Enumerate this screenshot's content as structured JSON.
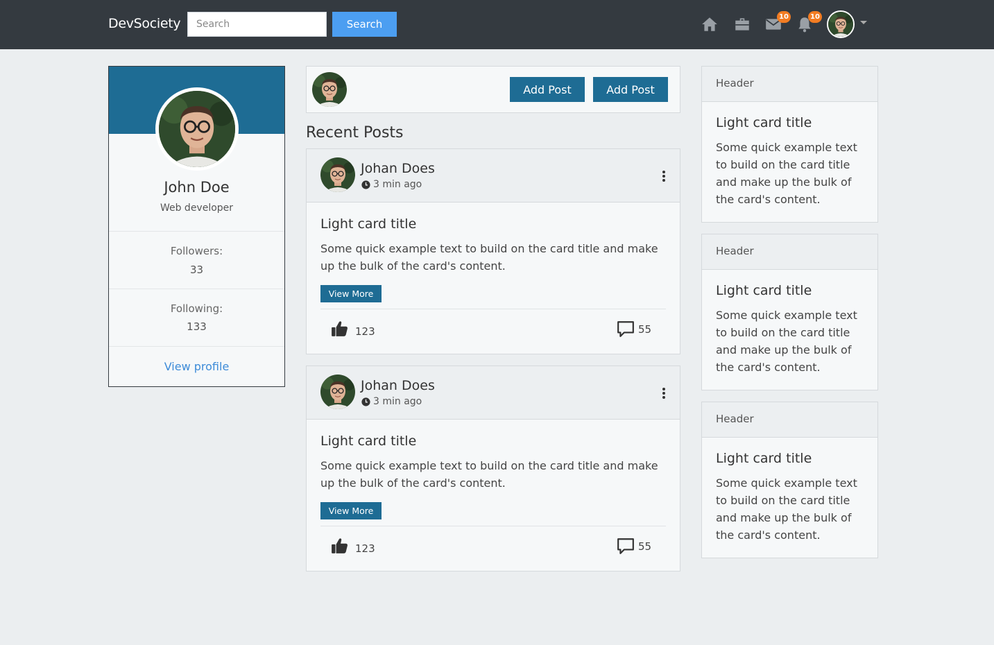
{
  "navbar": {
    "brand": "DevSociety",
    "search_placeholder": "Search",
    "search_button": "Search",
    "icons": [
      "home-icon",
      "briefcase-icon",
      "envelope-icon",
      "bell-icon"
    ],
    "messages_badge": "10",
    "notifications_badge": "10"
  },
  "profile": {
    "name": "John Doe",
    "role": "Web developer",
    "followers_label": "Followers:",
    "followers_value": "33",
    "following_label": "Following:",
    "following_value": "133",
    "view_profile": "View profile"
  },
  "compose": {
    "add_post_1": "Add Post",
    "add_post_2": "Add Post"
  },
  "feed": {
    "section_title": "Recent Posts",
    "posts": [
      {
        "author": "Johan Does",
        "time": "3 min ago",
        "title": "Light card title",
        "text": "Some quick example text to build on the card title and make up the bulk of the card's content.",
        "view_more": "View More",
        "likes": "123",
        "comments": "55"
      },
      {
        "author": "Johan Does",
        "time": "3 min ago",
        "title": "Light card title",
        "text": "Some quick example text to build on the card title and make up the bulk of the card's content.",
        "view_more": "View More",
        "likes": "123",
        "comments": "55"
      }
    ]
  },
  "sidebar": {
    "cards": [
      {
        "header": "Header",
        "title": "Light card title",
        "text": "Some quick example text to build on the card title and make up the bulk of the card's content."
      },
      {
        "header": "Header",
        "title": "Light card title",
        "text": "Some quick example text to build on the card title and make up the bulk of the card's content."
      },
      {
        "header": "Header",
        "title": "Light card title",
        "text": "Some quick example text to build on the card title and make up the bulk of the card's content."
      }
    ]
  },
  "colors": {
    "navbar": "#343a40",
    "primary": "#1e6c94",
    "search_button": "#4c9ef1",
    "badge": "#f27c22",
    "link": "#3d8bd8",
    "background": "#ebeef0"
  }
}
